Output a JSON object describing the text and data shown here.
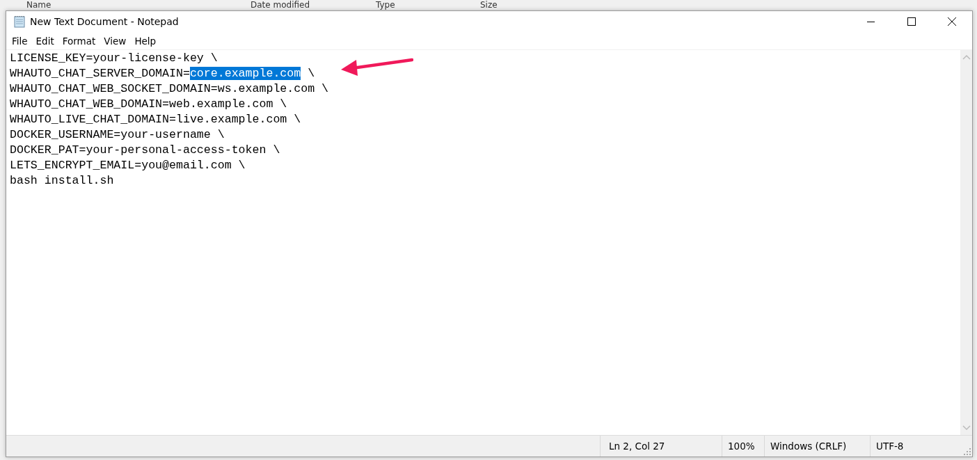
{
  "background_columns": [
    {
      "label": "Name"
    },
    {
      "label": "Date modified"
    },
    {
      "label": "Type"
    },
    {
      "label": "Size"
    }
  ],
  "window": {
    "title": "New Text Document - Notepad"
  },
  "menu": [
    {
      "label": "File"
    },
    {
      "label": "Edit"
    },
    {
      "label": "Format"
    },
    {
      "label": "View"
    },
    {
      "label": "Help"
    }
  ],
  "editor": {
    "lines": [
      {
        "segments": [
          {
            "text": "LICENSE_KEY=your-license-key \\",
            "selected": false
          }
        ]
      },
      {
        "segments": [
          {
            "text": "WHAUTO_CHAT_SERVER_DOMAIN=",
            "selected": false
          },
          {
            "text": "core.example.com",
            "selected": true
          },
          {
            "text": " \\",
            "selected": false
          }
        ]
      },
      {
        "segments": [
          {
            "text": "WHAUTO_CHAT_WEB_SOCKET_DOMAIN=ws.example.com \\",
            "selected": false
          }
        ]
      },
      {
        "segments": [
          {
            "text": "WHAUTO_CHAT_WEB_DOMAIN=web.example.com \\",
            "selected": false
          }
        ]
      },
      {
        "segments": [
          {
            "text": "WHAUTO_LIVE_CHAT_DOMAIN=live.example.com \\",
            "selected": false
          }
        ]
      },
      {
        "segments": [
          {
            "text": "DOCKER_USERNAME=your-username \\",
            "selected": false
          }
        ]
      },
      {
        "segments": [
          {
            "text": "DOCKER_PAT=your-personal-access-token \\",
            "selected": false
          }
        ]
      },
      {
        "segments": [
          {
            "text": "LETS_ENCRYPT_EMAIL=you@email.com \\",
            "selected": false
          }
        ]
      },
      {
        "segments": [
          {
            "text": "bash install.sh",
            "selected": false
          }
        ]
      }
    ]
  },
  "status_bar": [
    {
      "text": "Ln 2, Col 27"
    },
    {
      "text": "100%"
    },
    {
      "text": "Windows (CRLF)"
    },
    {
      "text": "UTF-8"
    }
  ]
}
